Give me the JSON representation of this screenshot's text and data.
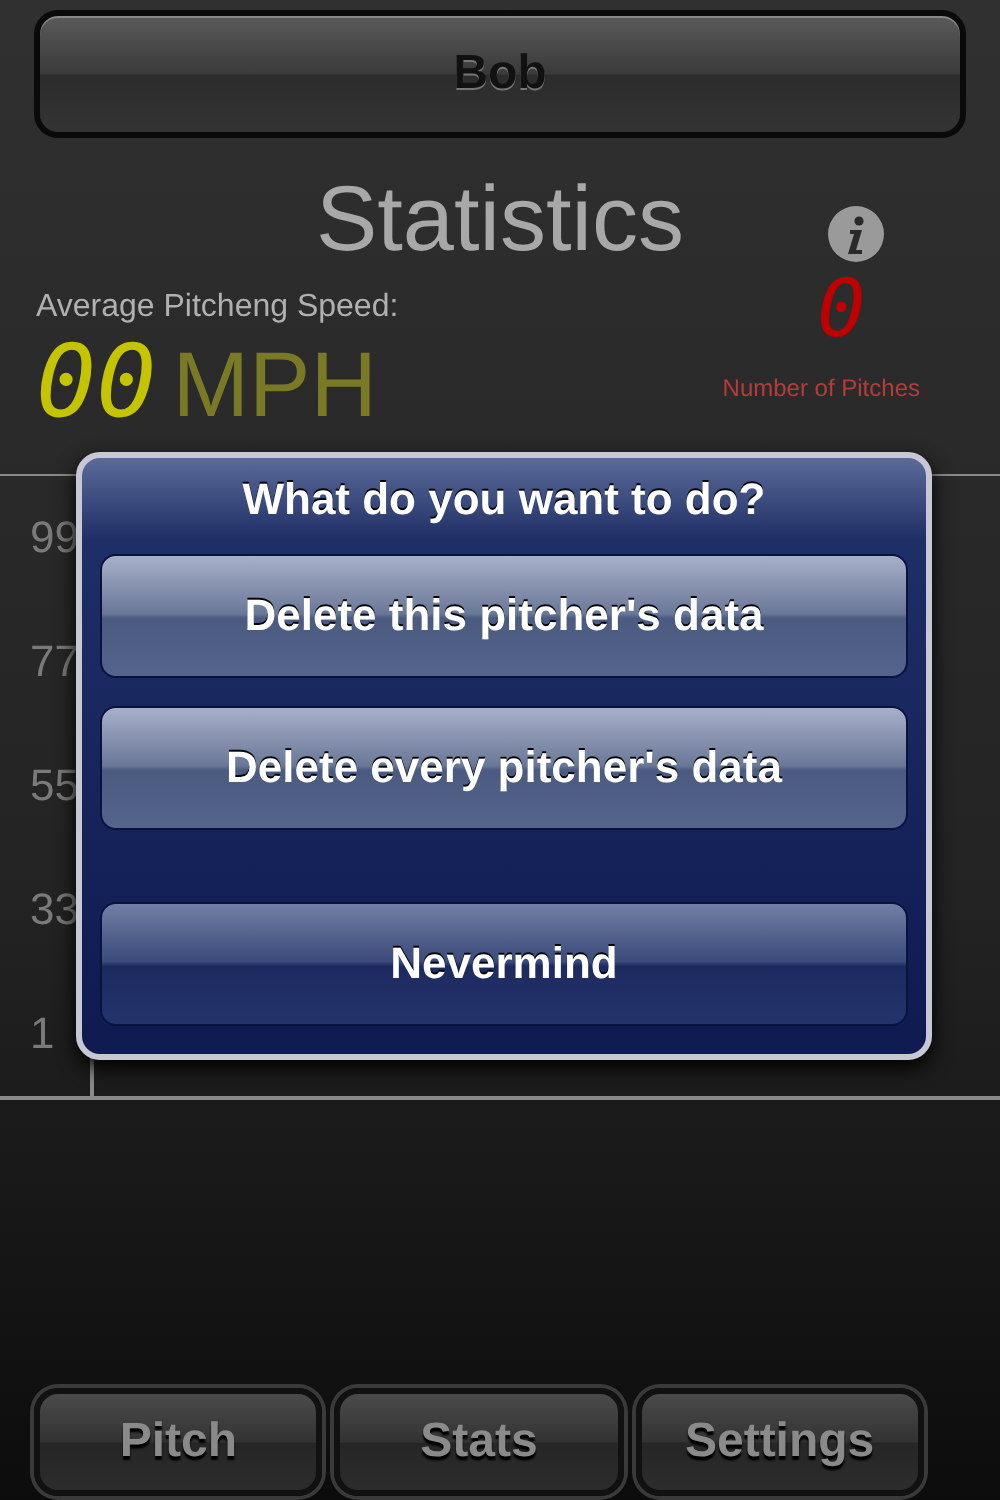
{
  "top_button": {
    "label": "Bob"
  },
  "title": "Statistics",
  "speed": {
    "label": "Average Pitcheng Speed:",
    "digits": "00",
    "unit": "MPH"
  },
  "pitches": {
    "digits": "0",
    "label": "Number of Pitches"
  },
  "chart": {
    "y_labels": [
      "99",
      "77",
      "55",
      "33",
      "1"
    ]
  },
  "dialog": {
    "title": "What do you want to do?",
    "buttons": [
      {
        "label": "Delete this pitcher's data",
        "kind": "action"
      },
      {
        "label": "Delete every pitcher's data",
        "kind": "action"
      },
      {
        "label": "Nevermind",
        "kind": "cancel"
      }
    ]
  },
  "tabs": [
    {
      "label": "Pitch"
    },
    {
      "label": "Stats"
    },
    {
      "label": "Settings"
    }
  ]
}
